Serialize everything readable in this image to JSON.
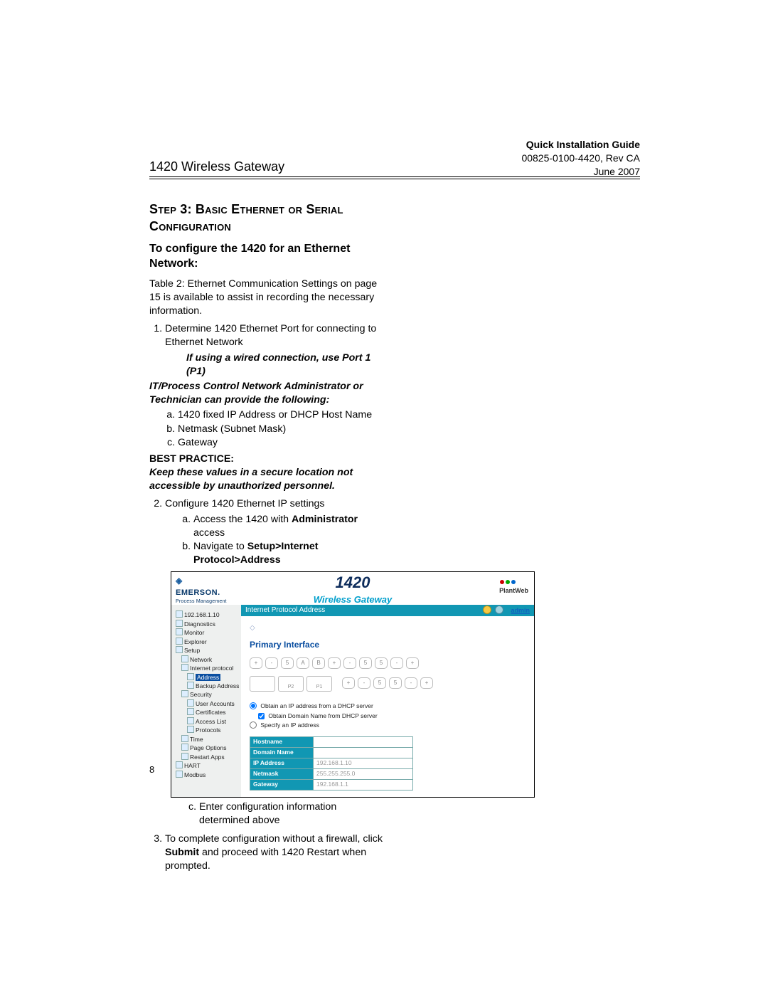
{
  "header": {
    "guide_title": "Quick Installation Guide",
    "doc_no": "00825-0100-4420, Rev CA",
    "date": "June 2007",
    "product": "1420 Wireless Gateway"
  },
  "step": {
    "heading_caps": "Step 3: Basic Ethernet or Serial Configuration",
    "subhead": "To configure the 1420 for an Ethernet Network:",
    "intro": "Table 2: Ethernet Communication Settings on page 15 is available to assist in recording the necessary information.",
    "li1": "Determine 1420 Ethernet Port for connecting to Ethernet Network",
    "li1_note": "If using a wired connection, use Port 1 (P1)",
    "it_line": "IT/Process Control Network Administrator or Technician can provide the following:",
    "la1": "1420 fixed IP Address or DHCP Host Name",
    "la2": "Netmask (Subnet Mask)",
    "la3": "Gateway",
    "bp_label": "BEST PRACTICE:",
    "bp_text": "Keep these values in a secure location not accessible by unauthorized personnel.",
    "li2": "Configure 1420 Ethernet IP settings",
    "lb2a_pre": "Access the 1420 with ",
    "lb2a_bold": "Administrator",
    "lb2a_post": " access",
    "lb2b_pre": "Navigate to ",
    "lb2b_bold": "Setup>Internet Protocol>Address",
    "lb2c": "Enter configuration information determined above",
    "li3_pre": "To complete configuration without a firewall, click ",
    "li3_bold": "Submit",
    "li3_post": " and proceed with 1420 Restart when prompted."
  },
  "page_number": "8",
  "shot": {
    "brand": "EMERSON.",
    "brand_sub": "Process Management",
    "title_num": "1420",
    "title_sub": "Wireless Gateway",
    "plantweb": "PlantWeb",
    "bar_title": "Internet Protocol Address",
    "admin_label": "admin",
    "sidebar": [
      {
        "level": 1,
        "text": "192.168.1.10"
      },
      {
        "level": 1,
        "text": "Diagnostics"
      },
      {
        "level": 1,
        "text": "Monitor"
      },
      {
        "level": 1,
        "text": "Explorer"
      },
      {
        "level": 1,
        "text": "Setup"
      },
      {
        "level": 2,
        "text": "Network"
      },
      {
        "level": 2,
        "text": "Internet protocol"
      },
      {
        "level": 3,
        "text": "Address",
        "selected": true
      },
      {
        "level": 3,
        "text": "Backup Address"
      },
      {
        "level": 2,
        "text": "Security"
      },
      {
        "level": 3,
        "text": "User Accounts"
      },
      {
        "level": 3,
        "text": "Certificates"
      },
      {
        "level": 3,
        "text": "Access List"
      },
      {
        "level": 3,
        "text": "Protocols"
      },
      {
        "level": 2,
        "text": "Time"
      },
      {
        "level": 2,
        "text": "Page Options"
      },
      {
        "level": 2,
        "text": "Restart Apps"
      },
      {
        "level": 1,
        "text": "HART"
      },
      {
        "level": 1,
        "text": "Modbus"
      }
    ],
    "primary_interface": "Primary Interface",
    "slot_digits_top": [
      "+",
      "-",
      "5",
      "A",
      "B",
      "+",
      "-",
      "5",
      "5",
      "-",
      "+"
    ],
    "slot_digits_mid": [
      "+",
      "-",
      "5",
      "5",
      "-",
      "+"
    ],
    "port_labels": [
      "P2",
      "P1"
    ],
    "radio_dhcp": "Obtain an IP address from a DHCP server",
    "chk_domain": "Obtain Domain Name from DHCP server",
    "radio_specify": "Specify an IP address",
    "cfg": {
      "rows": [
        {
          "k": "Hostname",
          "v": ""
        },
        {
          "k": "Domain Name",
          "v": ""
        },
        {
          "k": "IP Address",
          "v": "192.168.1.10"
        },
        {
          "k": "Netmask",
          "v": "255.255.255.0"
        },
        {
          "k": "Gateway",
          "v": "192.168.1.1"
        }
      ]
    }
  }
}
